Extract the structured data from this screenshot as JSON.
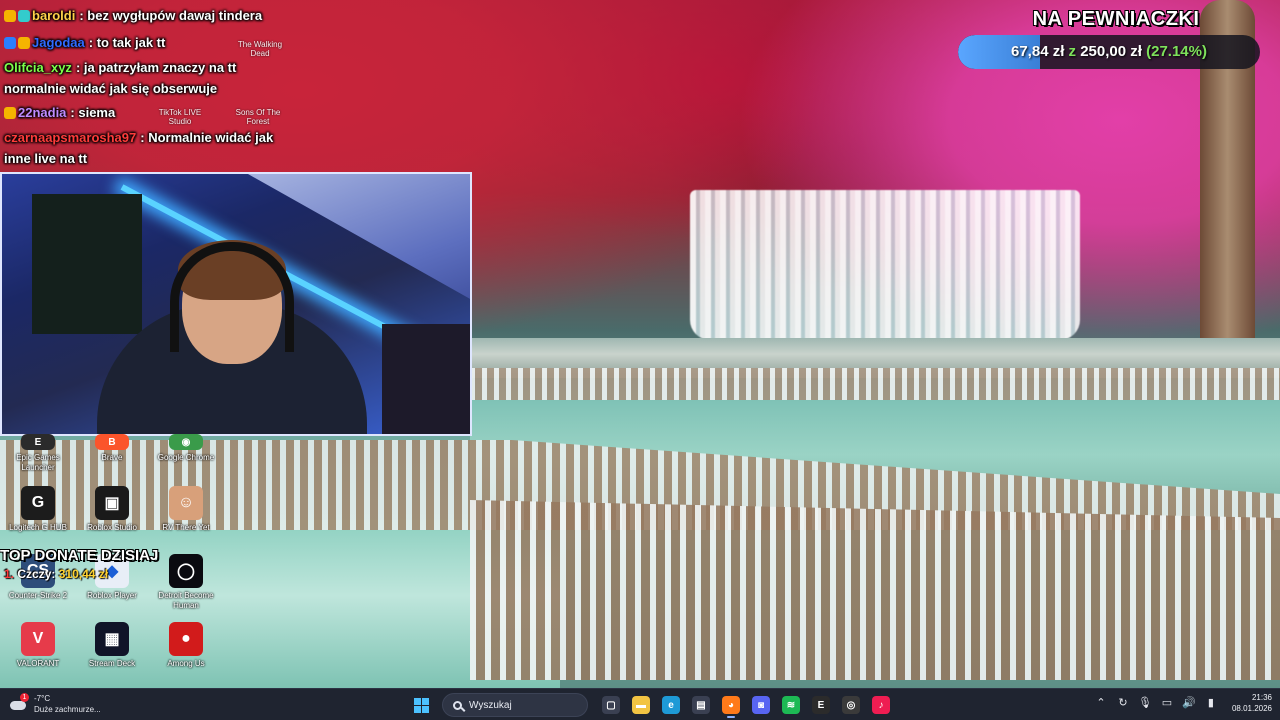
{
  "chat": {
    "lines": [
      {
        "user": "baroldi",
        "user_color": "#ffd24a",
        "message": ": bez wygłupów dawaj tindera"
      },
      {
        "user": "Jagodaa",
        "user_color": "#2f6bff",
        "message": ": to tak jak tt"
      },
      {
        "user": "Olifcia_xyz",
        "user_color": "#7cff4a",
        "message": ": ja patrzyłam znaczy na tt"
      },
      {
        "user": "",
        "user_color": "#ffffff",
        "message": "normalnie widać jak się obserwuje"
      },
      {
        "user": "22nadia",
        "user_color": "#c08bff",
        "message": ": siema"
      },
      {
        "user": "czarnaapsmarosha97",
        "user_color": "#ff3b3b",
        "message": ": Normalnie widać jak"
      },
      {
        "user": "",
        "user_color": "#ffffff",
        "message": "inne live na tt"
      }
    ]
  },
  "goal": {
    "title": "NA PEWNIACZKI",
    "current": "67,84 zł",
    "separator": "z",
    "target": "250,00 zł",
    "percent_label": "(27.14%)",
    "progress": 0.2714
  },
  "top_donate": {
    "title": "TOP DONATE DZISIAJ",
    "rank": "1.",
    "name": "Czczy:",
    "amount": "310,44 zł"
  },
  "desktop_icons": [
    {
      "label": "Epic Games Launcher",
      "icon": "epic-games-icon",
      "color": "#2b2b2b",
      "glyph": "E"
    },
    {
      "label": "Brave",
      "icon": "brave-icon",
      "color": "#fb542b",
      "glyph": "B"
    },
    {
      "label": "Google Chrome",
      "icon": "chrome-icon",
      "color": "#3a9b4a",
      "glyph": "◉"
    },
    {
      "label": "Logitech G HUB",
      "icon": "logitech-icon",
      "color": "#1c1c1c",
      "glyph": "G"
    },
    {
      "label": "Roblox Studio",
      "icon": "roblox-studio-icon",
      "color": "#1a1a1a",
      "glyph": "▣"
    },
    {
      "label": "RV There Yet",
      "icon": "rv-there-yet-icon",
      "color": "#d8a07a",
      "glyph": "☺"
    },
    {
      "label": "Counter-Strike 2",
      "icon": "counter-strike-icon",
      "color": "#2d4d7a",
      "glyph": "CS"
    },
    {
      "label": "Roblox Player",
      "icon": "roblox-player-icon",
      "color": "#e8eef7",
      "glyph": "◆"
    },
    {
      "label": "Detroit Become Human",
      "icon": "detroit-icon",
      "color": "#0a0a10",
      "glyph": "◯"
    },
    {
      "label": "VALORANT",
      "icon": "valorant-icon",
      "color": "#e63b4a",
      "glyph": "V"
    },
    {
      "label": "Stream Deck",
      "icon": "stream-deck-icon",
      "color": "#101428",
      "glyph": "▦"
    },
    {
      "label": "Among Us",
      "icon": "among-us-icon",
      "color": "#d21b1b",
      "glyph": "●"
    }
  ],
  "faded_icons": [
    {
      "label": "The Walking Dead"
    },
    {
      "label": "TikTok LIVE Studio"
    },
    {
      "label": "Sons Of The Forest"
    }
  ],
  "taskbar": {
    "weather_temp": "-7°C",
    "weather_desc": "Duże zachmurze...",
    "search_placeholder": "Wyszukaj",
    "time": "21:36",
    "date": "08.01.2026",
    "apps": [
      {
        "name": "task-view-icon",
        "glyph": "▢",
        "color": "#3a4052"
      },
      {
        "name": "file-explorer-icon",
        "glyph": "▬",
        "color": "#f2c443"
      },
      {
        "name": "edge-icon",
        "glyph": "e",
        "color": "#1e9ad6"
      },
      {
        "name": "ms-store-icon",
        "glyph": "▤",
        "color": "#3a4052"
      },
      {
        "name": "firefox-icon",
        "glyph": "◕",
        "color": "#ff7a1a"
      },
      {
        "name": "discord-icon",
        "glyph": "◙",
        "color": "#5865f2"
      },
      {
        "name": "spotify-icon",
        "glyph": "≋",
        "color": "#1db954"
      },
      {
        "name": "epic-games-taskbar-icon",
        "glyph": "E",
        "color": "#2b2b2b"
      },
      {
        "name": "obs-icon",
        "glyph": "◎",
        "color": "#3a3a3a"
      },
      {
        "name": "tiktok-icon",
        "glyph": "♪",
        "color": "#ee1d52"
      }
    ]
  }
}
